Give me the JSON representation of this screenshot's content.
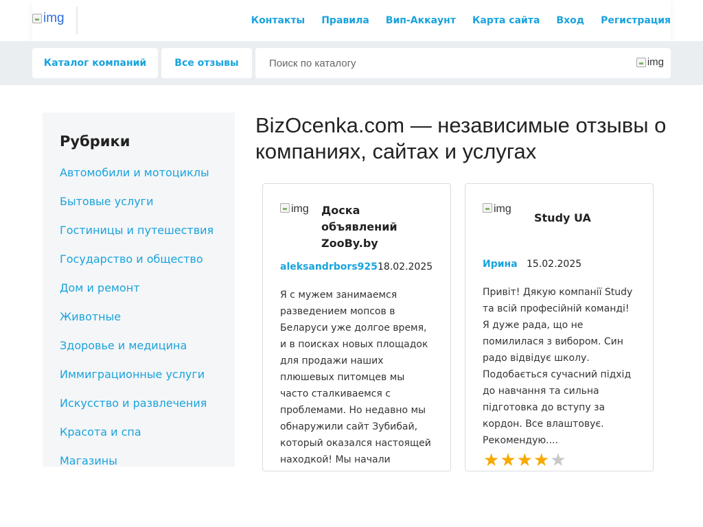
{
  "header": {
    "logo_alt": "img",
    "nav": [
      "Контакты",
      "Правила",
      "Вип-Аккаунт",
      "Карта сайта",
      "Вход",
      "Регистрация"
    ]
  },
  "subbar": {
    "catalog_label": "Каталог компаний",
    "reviews_label": "Все отзывы",
    "search_placeholder": "Поиск по каталогу",
    "search_icon_alt": "img"
  },
  "sidebar": {
    "title": "Рубрики",
    "items": [
      "Автомобили и мотоциклы",
      "Бытовые услуги",
      "Гостиницы и путешествия",
      "Государство и общество",
      "Дом и ремонт",
      "Животные",
      "Здоровье и медицина",
      "Иммиграционные услуги",
      "Искусство и развлечения",
      "Красота и спа",
      "Магазины"
    ]
  },
  "main": {
    "title": "BizOcenka.com — независимые отзывы о компаниях, сайтах и услугах",
    "cards": [
      {
        "img_alt": "img",
        "company": "Доска объявлений ZooBy.by",
        "author": "aleksandrbors925",
        "date": "18.02.2025",
        "text": "Я с мужем занимаемся разведением мопсов в Беларуси уже долгое время, и в поисках новых площадок для продажи наших плюшевых питомцев мы часто сталкиваемся с проблемами. Но недавно мы обнаружили сайт Зубибай, который оказался настоящей находкой! Мы начали активно"
      },
      {
        "img_alt": "img",
        "company": "Study UA",
        "author": "Ирина",
        "date": "15.02.2025",
        "text": "Привіт! Дякую компанії Study та всій професійній команді! Я дуже рада, що не помилилася з вибором. Син радо відвідує школу. Подобається сучасний підхід до навчання та сильна підготовка до вступу за кордон. Все влаштовує. Рекомендую....",
        "rating": 4,
        "rating_max": 5
      }
    ]
  },
  "colors": {
    "accent": "#19a3dc",
    "star": "#f7a900",
    "star_empty": "#c8c8c8",
    "subbar_bg": "#ebeef1",
    "sidebar_bg": "#f5f6f8"
  }
}
